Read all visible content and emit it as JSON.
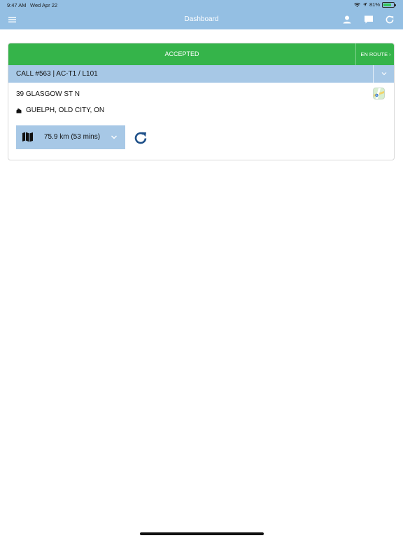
{
  "status_bar": {
    "time": "9:47 AM",
    "date": "Wed Apr 22",
    "battery_pct_label": "81%",
    "battery_level": 0.81
  },
  "header": {
    "title": "Dashboard",
    "icons": [
      "menu-icon",
      "user-icon",
      "chat-icon",
      "refresh-icon"
    ]
  },
  "call_card": {
    "status_label": "ACCEPTED",
    "next_status_label": "EN ROUTE",
    "call_label": "CALL #563 | AC-T1 / L101",
    "address": "39 GLASGOW ST N",
    "city": "GUELPH, OLD CITY, ON",
    "route_label": "75.9 km (53 mins)"
  },
  "colors": {
    "header_bg": "#94bfe3",
    "accepted_green": "#35b44a",
    "call_row_bg": "#a7c8e6",
    "accent_blue": "#1d4f88"
  }
}
